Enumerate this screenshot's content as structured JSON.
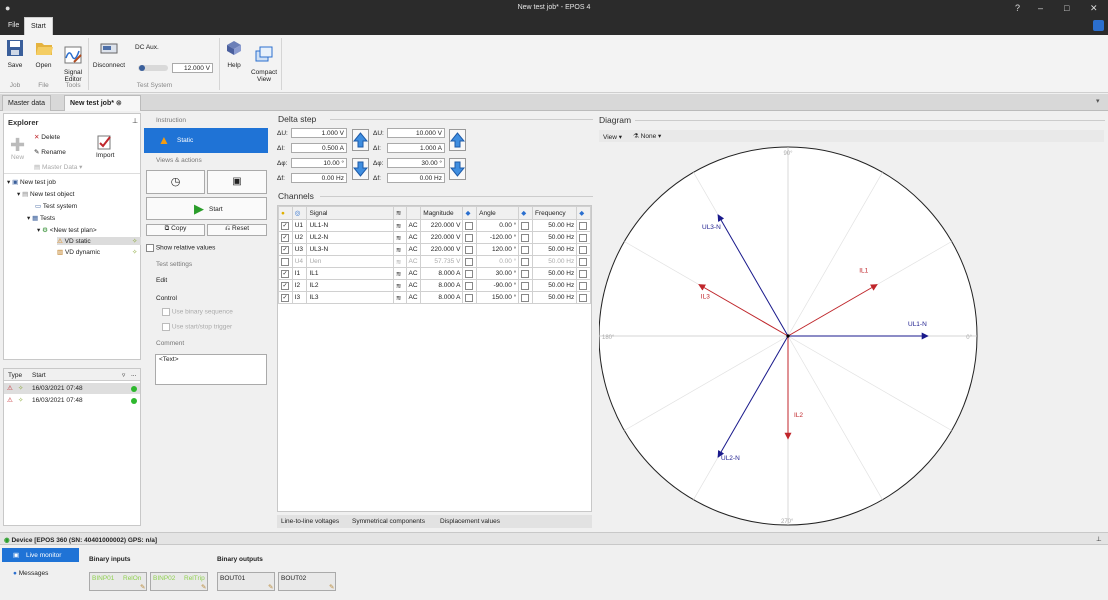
{
  "window": {
    "title": "New test job* - EPOS 4"
  },
  "ribbon_tabs": [
    "File",
    "Start"
  ],
  "ribbon": {
    "save": "Save",
    "open": "Open",
    "signal_editor": "Signal\nEditor",
    "disconnect": "Disconnect",
    "dc_aux_label": "DC Aux.",
    "dc_aux_value": "12.000 V",
    "help": "Help",
    "compact_view": "Compact\nView",
    "groups": {
      "job": "Job",
      "file": "File",
      "tools": "Tools",
      "test_system": "Test System"
    }
  },
  "doc_tabs": [
    "Master data",
    "New test job*"
  ],
  "explorer": {
    "title": "Explorer",
    "new": "New",
    "delete": "Delete",
    "rename": "Rename",
    "master_data": "Master Data",
    "import": "Import",
    "tree": [
      "New test job",
      "New test object",
      "Test system",
      "Tests",
      "<New test plan>",
      "VD static",
      "VD dynamic"
    ],
    "results_headers": [
      "Type",
      "Start",
      "..."
    ],
    "results": [
      {
        "start": "16/03/2021 07:48"
      },
      {
        "start": "16/03/2021 07:48"
      }
    ]
  },
  "instruction": {
    "section": "Instruction",
    "static": "Static",
    "views_actions": "Views & actions",
    "start": "Start",
    "copy": "Copy",
    "reset": "Reset",
    "show_relative": "Show relative values",
    "test_settings": "Test settings",
    "edit": "Edit",
    "control": "Control",
    "use_binary": "Use binary sequence",
    "use_trigger": "Use start/stop trigger",
    "comment": "Comment",
    "comment_text": "<Text>"
  },
  "delta_step": {
    "title": "Delta step",
    "left": [
      {
        "label": "ΔU:",
        "value": "1.000 V"
      },
      {
        "label": "ΔI:",
        "value": "0.500 A"
      },
      {
        "label": "Δφ:",
        "value": "10.00 °"
      },
      {
        "label": "Δf:",
        "value": "0.00 Hz"
      }
    ],
    "right": [
      {
        "label": "ΔU:",
        "value": "10.000 V"
      },
      {
        "label": "ΔI:",
        "value": "1.000 A"
      },
      {
        "label": "Δφ:",
        "value": "30.00 °"
      },
      {
        "label": "Δf:",
        "value": "0.00 Hz"
      }
    ]
  },
  "channels": {
    "title": "Channels",
    "headers": {
      "signal": "Signal",
      "magnitude": "Magnitude",
      "angle": "Angle",
      "frequency": "Frequency"
    },
    "rows": [
      {
        "check": "✓",
        "ch": "U1",
        "signal": "UL1-N",
        "type": "AC",
        "mag": "220.000 V",
        "ang": "0.00 °",
        "freq": "50.00 Hz",
        "dim": false
      },
      {
        "check": "✓",
        "ch": "U2",
        "signal": "UL2-N",
        "type": "AC",
        "mag": "220.000 V",
        "ang": "-120.00 °",
        "freq": "50.00 Hz",
        "dim": false
      },
      {
        "check": "✓",
        "ch": "U3",
        "signal": "UL3-N",
        "type": "AC",
        "mag": "220.000 V",
        "ang": "120.00 °",
        "freq": "50.00 Hz",
        "dim": false
      },
      {
        "check": "",
        "ch": "U4",
        "signal": "Uen",
        "type": "AC",
        "mag": "57.735 V",
        "ang": "0.00 °",
        "freq": "50.00 Hz",
        "dim": true
      },
      {
        "check": "✓",
        "ch": "I1",
        "signal": "IL1",
        "type": "AC",
        "mag": "8.000 A",
        "ang": "30.00 °",
        "freq": "50.00 Hz",
        "dim": false
      },
      {
        "check": "✓",
        "ch": "I2",
        "signal": "IL2",
        "type": "AC",
        "mag": "8.000 A",
        "ang": "-90.00 °",
        "freq": "50.00 Hz",
        "dim": false
      },
      {
        "check": "✓",
        "ch": "I3",
        "signal": "IL3",
        "type": "AC",
        "mag": "8.000 A",
        "ang": "150.00 °",
        "freq": "50.00 Hz",
        "dim": false
      }
    ],
    "bottom_tabs": [
      "Line-to-line voltages",
      "Symmetrical components",
      "Displacement values"
    ]
  },
  "diagram": {
    "title": "Diagram",
    "view": "View",
    "none": "None",
    "axis_labels": [
      "90°",
      "0°",
      "180°",
      "270°"
    ],
    "phasors": [
      {
        "name": "UL1-N",
        "angle": 0,
        "mag": 220,
        "color": "#1a1a8c"
      },
      {
        "name": "UL2-N",
        "angle": -120,
        "mag": 220,
        "color": "#1a1a8c"
      },
      {
        "name": "UL3-N",
        "angle": 120,
        "mag": 220,
        "color": "#1a1a8c"
      },
      {
        "name": "IL1",
        "angle": 30,
        "mag": 8,
        "color": "#c0262b"
      },
      {
        "name": "IL2",
        "angle": -90,
        "mag": 8,
        "color": "#c0262b"
      },
      {
        "name": "IL3",
        "angle": 150,
        "mag": 8,
        "color": "#c0262b"
      }
    ]
  },
  "device": {
    "title": "Device [EPOS 360 (SN: 40401000002) GPS: n/a]",
    "live_monitor": "Live monitor",
    "messages": "Messages",
    "binary_inputs": "Binary inputs",
    "binary_outputs": "Binary outputs",
    "bin_in": [
      {
        "name": "BINP01",
        "tag": "RelOn"
      },
      {
        "name": "BINP02",
        "tag": "RelTrip"
      }
    ],
    "bin_out": [
      "BOUT01",
      "BOUT02"
    ]
  }
}
